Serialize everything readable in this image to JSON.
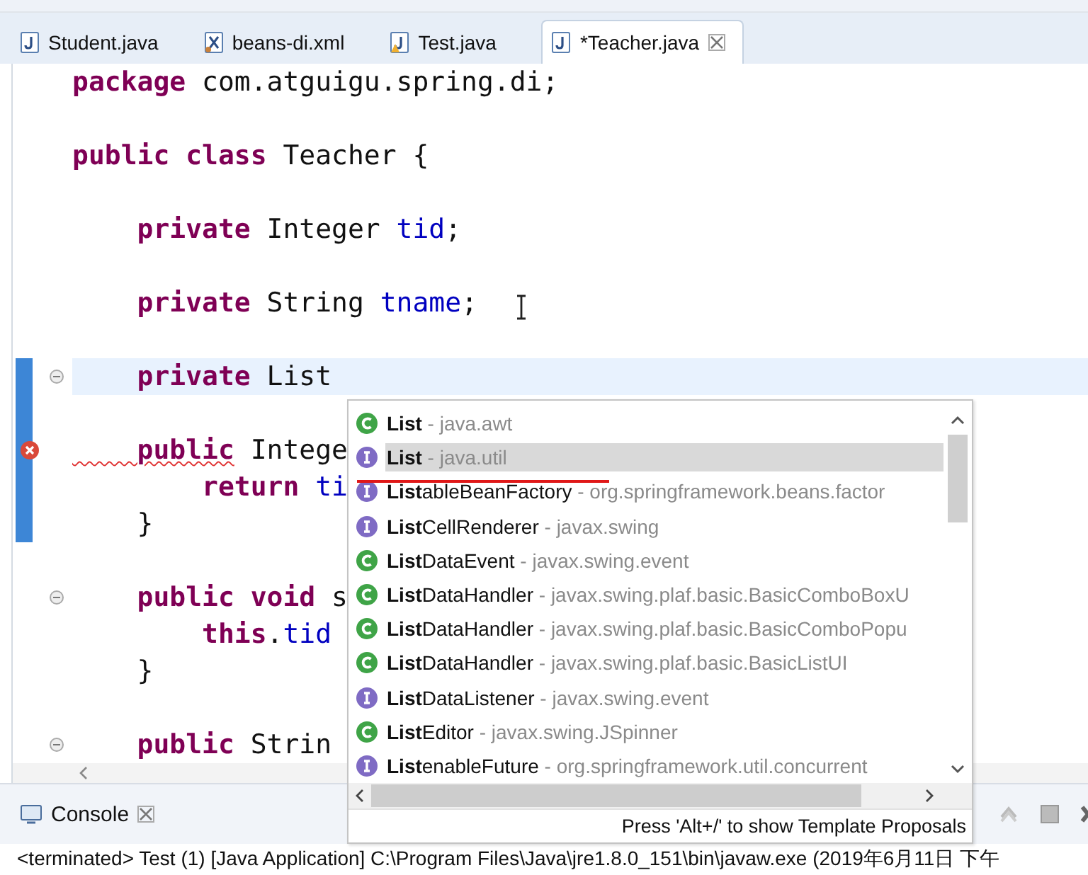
{
  "tabs": [
    {
      "label": "Student.java",
      "kind": "java",
      "selected": false,
      "closable": false
    },
    {
      "label": "beans-di.xml",
      "kind": "xml",
      "selected": false,
      "closable": false
    },
    {
      "label": "Test.java",
      "kind": "java",
      "selected": false,
      "closable": false,
      "warning": true
    },
    {
      "label": "*Teacher.java",
      "kind": "java",
      "selected": true,
      "closable": true
    }
  ],
  "editor": {
    "lines": [
      {
        "kind": "code",
        "tokens": [
          {
            "kind": "keyword",
            "text": "package"
          },
          {
            "kind": "plain",
            "text": " com.atguigu.spring.di;"
          }
        ]
      },
      {
        "kind": "blank"
      },
      {
        "kind": "code",
        "tokens": [
          {
            "kind": "keyword",
            "text": "public class"
          },
          {
            "kind": "plain",
            "text": " Teacher {"
          }
        ]
      },
      {
        "kind": "blank"
      },
      {
        "kind": "code",
        "tokens": [
          {
            "kind": "keyword",
            "text": "    private"
          },
          {
            "kind": "plain",
            "text": " Integer "
          },
          {
            "kind": "field",
            "text": "tid"
          },
          {
            "kind": "plain",
            "text": ";"
          }
        ]
      },
      {
        "kind": "blank"
      },
      {
        "kind": "code",
        "tokens": [
          {
            "kind": "keyword",
            "text": "    private"
          },
          {
            "kind": "plain",
            "text": " String "
          },
          {
            "kind": "field",
            "text": "tname"
          },
          {
            "kind": "plain",
            "text": ";"
          }
        ]
      },
      {
        "kind": "blank"
      },
      {
        "kind": "code",
        "ruler": true,
        "fold": true,
        "current": true,
        "tokens": [
          {
            "kind": "keyword",
            "text": "    private"
          },
          {
            "kind": "plain",
            "text": " List"
          }
        ]
      },
      {
        "kind": "blank",
        "ruler": true
      },
      {
        "kind": "code",
        "ruler": true,
        "error": true,
        "tokens": [
          {
            "kind": "keyword",
            "text": "    public",
            "squiggle": true
          },
          {
            "kind": "plain",
            "text": " Intege"
          }
        ]
      },
      {
        "kind": "code",
        "ruler": true,
        "tokens": [
          {
            "kind": "keyword",
            "text": "        return"
          },
          {
            "kind": "field",
            "text": " ti"
          }
        ]
      },
      {
        "kind": "code",
        "ruler": true,
        "tokens": [
          {
            "kind": "plain",
            "text": "    }"
          }
        ]
      },
      {
        "kind": "blank"
      },
      {
        "kind": "code",
        "fold": true,
        "tokens": [
          {
            "kind": "keyword",
            "text": "    public void"
          },
          {
            "kind": "plain",
            "text": " s"
          }
        ]
      },
      {
        "kind": "code",
        "tokens": [
          {
            "kind": "keyword",
            "text": "        this"
          },
          {
            "kind": "plain",
            "text": "."
          },
          {
            "kind": "field",
            "text": "tid"
          }
        ]
      },
      {
        "kind": "code",
        "tokens": [
          {
            "kind": "plain",
            "text": "    }"
          }
        ]
      },
      {
        "kind": "blank"
      },
      {
        "kind": "code",
        "fold": true,
        "tokens": [
          {
            "kind": "keyword",
            "text": "    public"
          },
          {
            "kind": "plain",
            "text": " Strin"
          }
        ]
      }
    ]
  },
  "proposals": {
    "items": [
      {
        "kind": "class",
        "name": "**List**",
        "qualifier": "- java.awt",
        "selected": false
      },
      {
        "kind": "interface",
        "name": "**List**",
        "qualifier": "- java.util",
        "selected": true
      },
      {
        "kind": "interface",
        "name": "**List**ableBeanFactory",
        "qualifier": "- org.springframework.beans.factor",
        "selected": false
      },
      {
        "kind": "interface",
        "name": "**List**CellRenderer",
        "qualifier": "- javax.swing",
        "selected": false
      },
      {
        "kind": "class",
        "name": "**List**DataEvent",
        "qualifier": "- javax.swing.event",
        "selected": false
      },
      {
        "kind": "class",
        "name": "**List**DataHandler",
        "qualifier": "- javax.swing.plaf.basic.BasicComboBoxU",
        "selected": false
      },
      {
        "kind": "class",
        "name": "**List**DataHandler",
        "qualifier": "- javax.swing.plaf.basic.BasicComboPopu",
        "selected": false
      },
      {
        "kind": "class",
        "name": "**List**DataHandler",
        "qualifier": "- javax.swing.plaf.basic.BasicListUI",
        "selected": false
      },
      {
        "kind": "interface",
        "name": "**List**DataListener",
        "qualifier": "- javax.swing.event",
        "selected": false
      },
      {
        "kind": "class",
        "name": "**List**Editor",
        "qualifier": "- javax.swing.JSpinner",
        "selected": false
      },
      {
        "kind": "interface",
        "name": "**List**enableFuture",
        "qualifier": "- org.springframework.util.concurrent",
        "selected": false
      }
    ],
    "footer": "Press 'Alt+/' to show Template Proposals"
  },
  "console": {
    "title": "Console",
    "status": "<terminated> Test (1) [Java Application] C:\\Program Files\\Java\\jre1.8.0_151\\bin\\javaw.exe (2019年6月11日 下午"
  }
}
